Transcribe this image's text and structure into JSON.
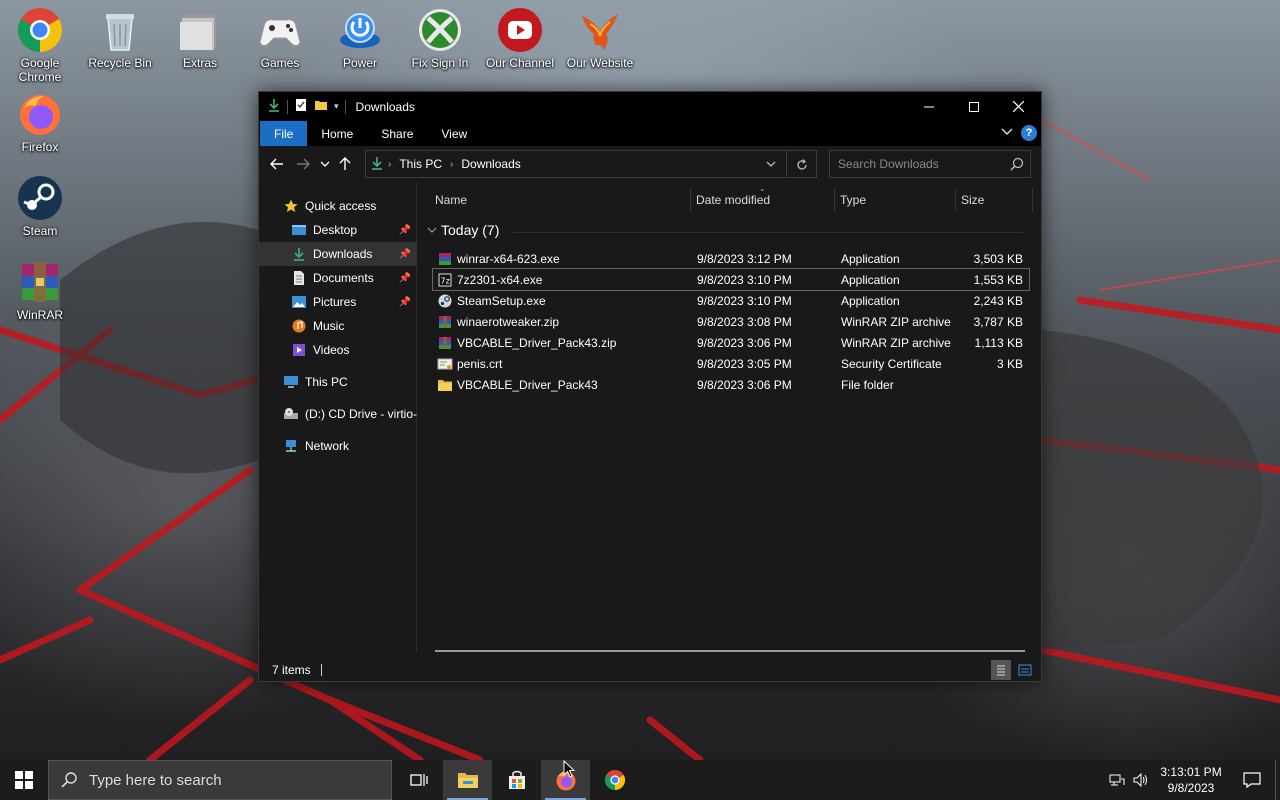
{
  "desktop": {
    "icons": [
      {
        "label": "Google Chrome",
        "icon": "chrome-icon"
      },
      {
        "label": "Recycle Bin",
        "icon": "recycle-bin-icon"
      },
      {
        "label": "Extras",
        "icon": "folder-stack-icon"
      },
      {
        "label": "Games",
        "icon": "gamepad-icon"
      },
      {
        "label": "Power",
        "icon": "power-icon"
      },
      {
        "label": "Fix Sign In",
        "icon": "xbox-icon"
      },
      {
        "label": "Our Channel",
        "icon": "youtube-icon"
      },
      {
        "label": "Our Website",
        "icon": "phoenix-icon"
      },
      {
        "label": "Firefox",
        "icon": "firefox-icon"
      },
      {
        "label": "Steam",
        "icon": "steam-icon"
      },
      {
        "label": "WinRAR",
        "icon": "winrar-icon"
      }
    ]
  },
  "window": {
    "title": "Downloads",
    "ribbon_tabs": [
      "File",
      "Home",
      "Share",
      "View"
    ],
    "help": "?",
    "breadcrumb": [
      "This PC",
      "Downloads"
    ],
    "search_placeholder": "Search Downloads",
    "nav_pane": [
      {
        "label": "Quick access",
        "icon": "star-icon"
      },
      {
        "label": "Desktop",
        "icon": "desktop-icon",
        "pinned": true
      },
      {
        "label": "Downloads",
        "icon": "download-icon",
        "pinned": true,
        "selected": true
      },
      {
        "label": "Documents",
        "icon": "documents-icon",
        "pinned": true
      },
      {
        "label": "Pictures",
        "icon": "pictures-icon",
        "pinned": true
      },
      {
        "label": "Music",
        "icon": "music-icon"
      },
      {
        "label": "Videos",
        "icon": "videos-icon"
      },
      {
        "label": "This PC",
        "icon": "computer-icon"
      },
      {
        "label": "(D:) CD Drive - virtio-",
        "icon": "cd-drive-icon"
      },
      {
        "label": "Network",
        "icon": "network-icon"
      }
    ],
    "columns": [
      "Name",
      "Date modified",
      "Type",
      "Size"
    ],
    "group_label": "Today (7)",
    "files": [
      {
        "name": "winrar-x64-623.exe",
        "date": "9/8/2023 3:12 PM",
        "type": "Application",
        "size": "3,503 KB",
        "icon": "winrar-file-icon"
      },
      {
        "name": "7z2301-x64.exe",
        "date": "9/8/2023 3:10 PM",
        "type": "Application",
        "size": "1,553 KB",
        "icon": "7zip-file-icon"
      },
      {
        "name": "SteamSetup.exe",
        "date": "9/8/2023 3:10 PM",
        "type": "Application",
        "size": "2,243 KB",
        "icon": "steam-file-icon"
      },
      {
        "name": "winaerotweaker.zip",
        "date": "9/8/2023 3:08 PM",
        "type": "WinRAR ZIP archive",
        "size": "3,787 KB",
        "icon": "zip-file-icon"
      },
      {
        "name": "VBCABLE_Driver_Pack43.zip",
        "date": "9/8/2023 3:06 PM",
        "type": "WinRAR ZIP archive",
        "size": "1,113 KB",
        "icon": "zip-file-icon"
      },
      {
        "name": "penis.crt",
        "date": "9/8/2023 3:05 PM",
        "type": "Security Certificate",
        "size": "3 KB",
        "icon": "certificate-file-icon"
      },
      {
        "name": "VBCABLE_Driver_Pack43",
        "date": "9/8/2023 3:06 PM",
        "type": "File folder",
        "size": "",
        "icon": "folder-icon"
      }
    ],
    "status": "7 items"
  },
  "taskbar": {
    "search_placeholder": "Type here to search",
    "time": "3:13:01 PM",
    "date": "9/8/2023"
  },
  "colors": {
    "accent": "#1a6fc4",
    "window_bg": "#191919",
    "titlebar_bg": "#000000",
    "taskbar_bg": "#1c1c1c"
  }
}
